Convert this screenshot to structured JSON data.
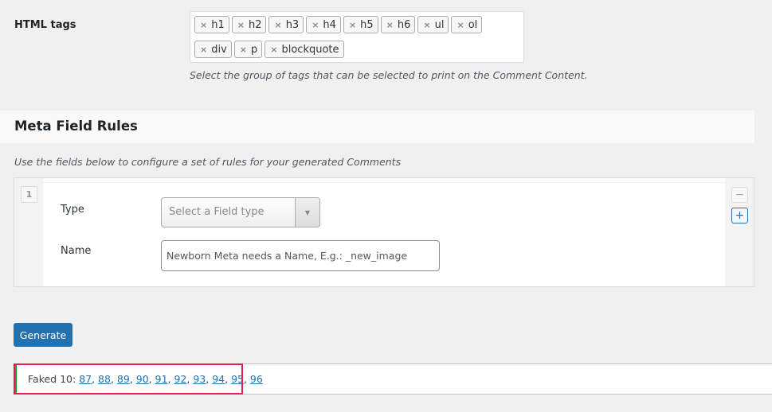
{
  "html_tags": {
    "label": "HTML tags",
    "tags": [
      "h1",
      "h2",
      "h3",
      "h4",
      "h5",
      "h6",
      "ul",
      "ol",
      "div",
      "p",
      "blockquote"
    ],
    "remove_glyph": "×",
    "help": "Select the group of tags that can be selected to print on the Comment Content."
  },
  "meta_rules": {
    "title": "Meta Field Rules",
    "description": "Use the fields below to configure a set of rules for your generated Comments",
    "rule": {
      "index": "1",
      "type_label": "Type",
      "type_placeholder": "Select a Field type",
      "type_arrow": "▼",
      "name_label": "Name",
      "name_placeholder": "Newborn Meta needs a Name, E.g.: _new_image",
      "name_value": ""
    },
    "remove_glyph": "−",
    "add_glyph": "+"
  },
  "generate_label": "Generate",
  "notice": {
    "prefix": "Faked 10: ",
    "links": [
      "87",
      "88",
      "89",
      "90",
      "91",
      "92",
      "93",
      "94",
      "95",
      "96"
    ],
    "accent": "#00a32a",
    "highlight": "#e0234e"
  }
}
